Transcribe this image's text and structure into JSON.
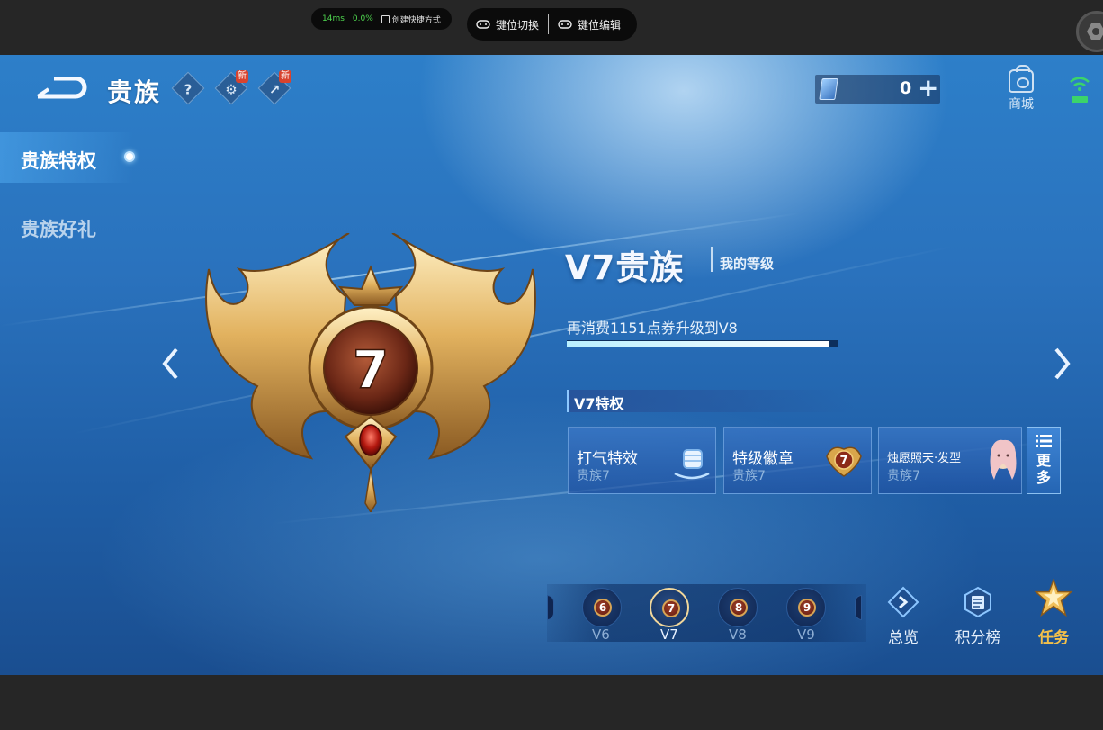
{
  "emulator": {
    "ping": "14ms",
    "loss": "0.0%",
    "shortcut_label": "创建快捷方式",
    "key_switch_label": "键位切换",
    "key_edit_label": "键位编辑"
  },
  "header": {
    "title": "贵族",
    "help_glyph": "?",
    "new_badge_1": "新",
    "new_badge_2": "新",
    "coupon_value": "0",
    "coupon_plus": "+",
    "shop_label": "商城"
  },
  "nav": {
    "items": [
      {
        "label": "贵族特权",
        "active": true
      },
      {
        "label": "贵族好礼",
        "active": false
      }
    ]
  },
  "emblem": {
    "level_number": "7"
  },
  "main": {
    "level_title": "V7贵族",
    "level_sub": "我的等级",
    "progress_text": "再消费1151点券升级到V8",
    "progress_fraction": 0.97,
    "perks_header": "V7特权",
    "perks": [
      {
        "name": "打气特效",
        "tier": "贵族7",
        "icon": "fist-effect-icon"
      },
      {
        "name": "特级徽章",
        "tier": "贵族7",
        "icon": "v7-badge-icon",
        "badge_number": "7"
      },
      {
        "name": "烛愿照天·发型",
        "tier": "贵族7",
        "icon": "hairstyle-avatar-icon"
      }
    ],
    "more_label_1": "更",
    "more_label_2": "多"
  },
  "levels": [
    {
      "num": "6",
      "label": "V6",
      "selected": false
    },
    {
      "num": "7",
      "label": "V7",
      "selected": true
    },
    {
      "num": "8",
      "label": "V8",
      "selected": false
    },
    {
      "num": "9",
      "label": "V9",
      "selected": false
    }
  ],
  "bottom_buttons": {
    "overview": "总览",
    "leaderboard": "积分榜",
    "tasks": "任务"
  },
  "colors": {
    "accent_gold": "#f3c04a",
    "bg_blue": "#2a72bd",
    "progress_fill": "#ffffff"
  }
}
